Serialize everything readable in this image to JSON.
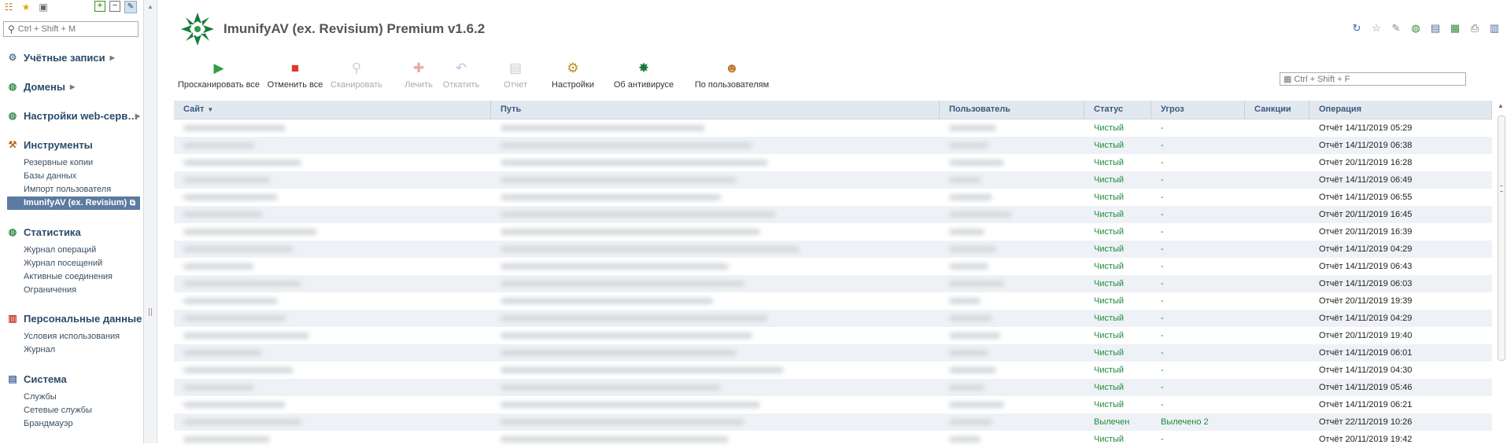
{
  "sidebar": {
    "search_placeholder": "Ctrl + Shift + M",
    "sections": [
      {
        "title": "Учётные записи",
        "icon": "accounts-icon",
        "has_arrow": true,
        "items": []
      },
      {
        "title": "Домены",
        "icon": "globe-icon",
        "has_arrow": true,
        "items": []
      },
      {
        "title": "Настройки web-серв…",
        "icon": "web-settings-icon",
        "has_arrow": true,
        "items": []
      },
      {
        "title": "Инструменты",
        "icon": "tools-icon",
        "has_arrow": false,
        "items": [
          "Резервные копии",
          "Базы данных",
          "Импорт пользователя",
          "ImunifyAV (ex. Revisium)"
        ],
        "active_index": 3
      },
      {
        "title": "Статистика",
        "icon": "globe-icon",
        "has_arrow": false,
        "items": [
          "Журнал операций",
          "Журнал посещений",
          "Активные соединения",
          "Ограничения"
        ]
      },
      {
        "title": "Персональные данные",
        "icon": "books-icon",
        "has_arrow": false,
        "items": [
          "Условия использования",
          "Журнал"
        ]
      },
      {
        "title": "Система",
        "icon": "system-icon",
        "has_arrow": false,
        "items": [
          "Службы",
          "Сетевые службы",
          "Брандмауэр"
        ]
      }
    ]
  },
  "app": {
    "title": "ImunifyAV (ex. Revisium) Premium v1.6.2",
    "brand_color": "#1a7a3a"
  },
  "toolbar": [
    {
      "label": "Просканировать все",
      "icon": "play-icon",
      "enabled": true
    },
    {
      "label": "Отменить все",
      "icon": "stop-icon",
      "enabled": true
    },
    {
      "label": "Сканировать",
      "icon": "magnifier-icon",
      "enabled": false
    },
    {
      "label": "Лечить",
      "icon": "first-aid-icon",
      "enabled": false
    },
    {
      "label": "Откатить",
      "icon": "rollback-icon",
      "enabled": false
    },
    {
      "label": "Отчет",
      "icon": "report-icon",
      "enabled": false
    },
    {
      "label": "Настройки",
      "icon": "settings-icon",
      "enabled": true
    },
    {
      "label": "Об антивирусе",
      "icon": "antivirus-logo-icon",
      "enabled": true
    },
    {
      "label": "По пользователям",
      "icon": "user-icon",
      "enabled": true
    }
  ],
  "table_search_placeholder": "Ctrl + Shift + F",
  "table": {
    "columns": [
      "Сайт",
      "Путь",
      "Пользователь",
      "Статус",
      "Угроз",
      "Санкции",
      "Операция"
    ],
    "sorted_column": "Сайт",
    "rows": [
      {
        "status": "Чистый",
        "threats": "-",
        "sanctions": "",
        "operation": "Отчёт 14/11/2019 05:29"
      },
      {
        "status": "Чистый",
        "threats": "-",
        "sanctions": "",
        "operation": "Отчёт 14/11/2019 06:38"
      },
      {
        "status": "Чистый",
        "threats": "-",
        "sanctions": "",
        "operation": "Отчёт 20/11/2019 16:28"
      },
      {
        "status": "Чистый",
        "threats": "-",
        "sanctions": "",
        "operation": "Отчёт 14/11/2019 06:49"
      },
      {
        "status": "Чистый",
        "threats": "-",
        "sanctions": "",
        "operation": "Отчёт 14/11/2019 06:55"
      },
      {
        "status": "Чистый",
        "threats": "-",
        "sanctions": "",
        "operation": "Отчёт 20/11/2019 16:45"
      },
      {
        "status": "Чистый",
        "threats": "-",
        "sanctions": "",
        "operation": "Отчёт 20/11/2019 16:39"
      },
      {
        "status": "Чистый",
        "threats": "-",
        "sanctions": "",
        "operation": "Отчёт 14/11/2019 04:29"
      },
      {
        "status": "Чистый",
        "threats": "-",
        "sanctions": "",
        "operation": "Отчёт 14/11/2019 06:43"
      },
      {
        "status": "Чистый",
        "threats": "-",
        "sanctions": "",
        "operation": "Отчёт 14/11/2019 06:03"
      },
      {
        "status": "Чистый",
        "threats": "-",
        "sanctions": "",
        "operation": "Отчёт 20/11/2019 19:39"
      },
      {
        "status": "Чистый",
        "threats": "-",
        "sanctions": "",
        "operation": "Отчёт 14/11/2019 04:29"
      },
      {
        "status": "Чистый",
        "threats": "-",
        "sanctions": "",
        "operation": "Отчёт 20/11/2019 19:40"
      },
      {
        "status": "Чистый",
        "threats": "-",
        "sanctions": "",
        "operation": "Отчёт 14/11/2019 06:01"
      },
      {
        "status": "Чистый",
        "threats": "-",
        "sanctions": "",
        "operation": "Отчёт 14/11/2019 04:30"
      },
      {
        "status": "Чистый",
        "threats": "-",
        "sanctions": "",
        "operation": "Отчёт 14/11/2019 05:46"
      },
      {
        "status": "Чистый",
        "threats": "-",
        "sanctions": "",
        "operation": "Отчёт 14/11/2019 06:21"
      },
      {
        "status": "Вылечен",
        "threats": "Вылечено 2",
        "sanctions": "",
        "operation": "Отчёт 22/11/2019 10:26"
      },
      {
        "status": "Чистый",
        "threats": "-",
        "sanctions": "",
        "operation": "Отчёт 20/11/2019 19:42"
      }
    ]
  }
}
